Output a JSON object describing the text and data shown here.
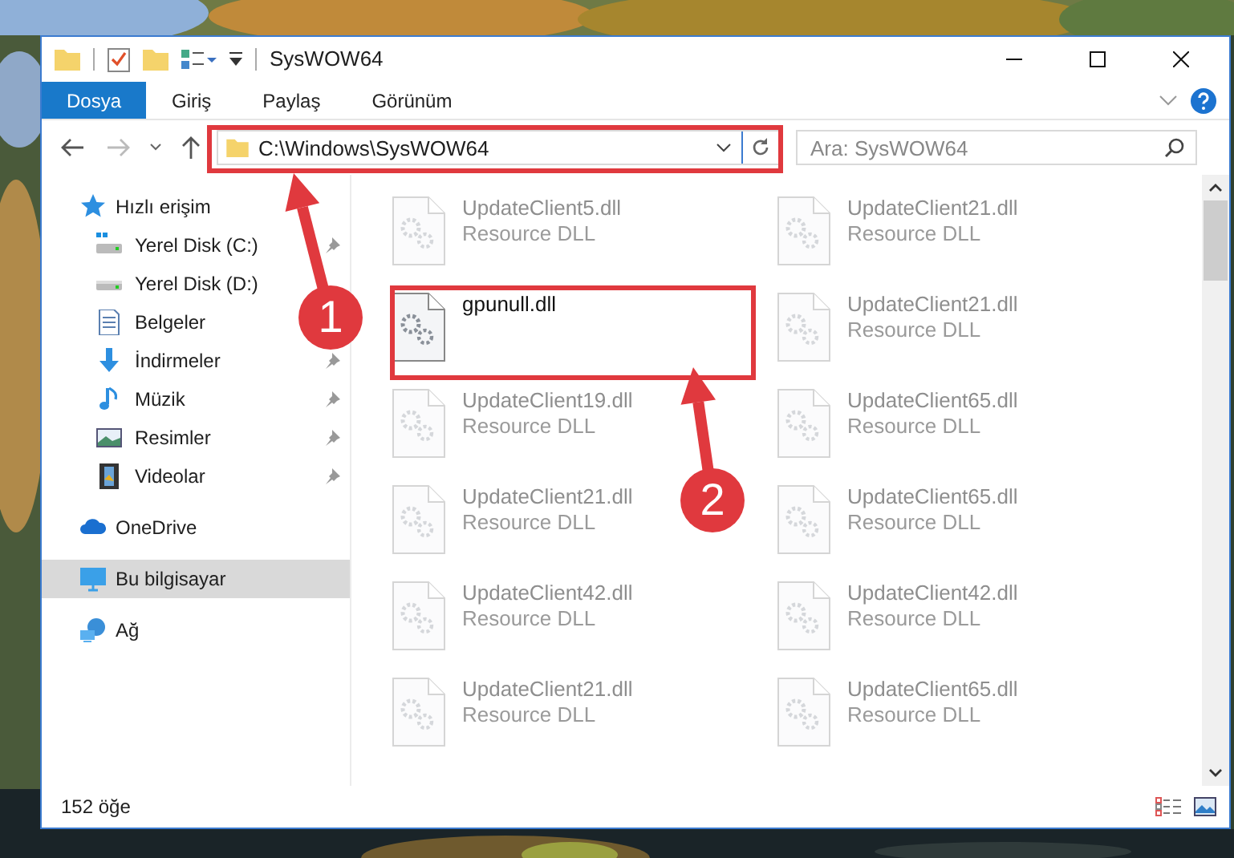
{
  "window": {
    "title": "SysWOW64"
  },
  "ribbon_tabs": [
    {
      "label": "Dosya",
      "selected": true
    },
    {
      "label": "Giriş",
      "selected": false
    },
    {
      "label": "Paylaş",
      "selected": false
    },
    {
      "label": "Görünüm",
      "selected": false
    }
  ],
  "address": {
    "value": "C:\\Windows\\SysWOW64"
  },
  "search": {
    "placeholder": "Ara: SysWOW64"
  },
  "sidebar": {
    "items": [
      {
        "label": "Hızlı erişim",
        "kind": "star",
        "selected": false,
        "children": [
          {
            "label": "Yerel Disk (C:)",
            "kind": "drive-c",
            "pinned": true
          },
          {
            "label": "Yerel Disk (D:)",
            "kind": "drive",
            "pinned": false
          },
          {
            "label": "Belgeler",
            "kind": "doc",
            "pinned": false
          },
          {
            "label": "İndirmeler",
            "kind": "download",
            "pinned": true
          },
          {
            "label": "Müzik",
            "kind": "music",
            "pinned": true
          },
          {
            "label": "Resimler",
            "kind": "pictures",
            "pinned": true
          },
          {
            "label": "Videolar",
            "kind": "video",
            "pinned": true
          }
        ]
      },
      {
        "label": "OneDrive",
        "kind": "cloud",
        "selected": false
      },
      {
        "label": "Bu bilgisayar",
        "kind": "pc",
        "selected": true
      },
      {
        "label": "Ağ",
        "kind": "network",
        "selected": false
      }
    ]
  },
  "files": [
    {
      "name": "UpdateClient5.dll",
      "type": "Resource DLL",
      "faded": true
    },
    {
      "name": "UpdateClient21.dll",
      "type": "Resource DLL",
      "faded": true
    },
    {
      "name": "gpunull.dll",
      "faded": false
    },
    {
      "name": "UpdateClient21.dll",
      "type": "Resource DLL",
      "faded": true
    },
    {
      "name": "UpdateClient19.dll",
      "type": "Resource DLL",
      "faded": true
    },
    {
      "name": "UpdateClient65.dll",
      "type": "Resource DLL",
      "faded": true
    },
    {
      "name": "UpdateClient21.dll",
      "type": "Resource DLL",
      "faded": true
    },
    {
      "name": "UpdateClient65.dll",
      "type": "Resource DLL",
      "faded": true
    },
    {
      "name": "UpdateClient42.dll",
      "type": "Resource DLL",
      "faded": true
    },
    {
      "name": "UpdateClient42.dll",
      "type": "Resource DLL",
      "faded": true
    },
    {
      "name": "UpdateClient21.dll",
      "type": "Resource DLL",
      "faded": true
    },
    {
      "name": "UpdateClient65.dll",
      "type": "Resource DLL",
      "faded": true
    }
  ],
  "status_bar": {
    "count": "152 öğe"
  },
  "annotations": [
    {
      "label": "1"
    },
    {
      "label": "2"
    }
  ]
}
